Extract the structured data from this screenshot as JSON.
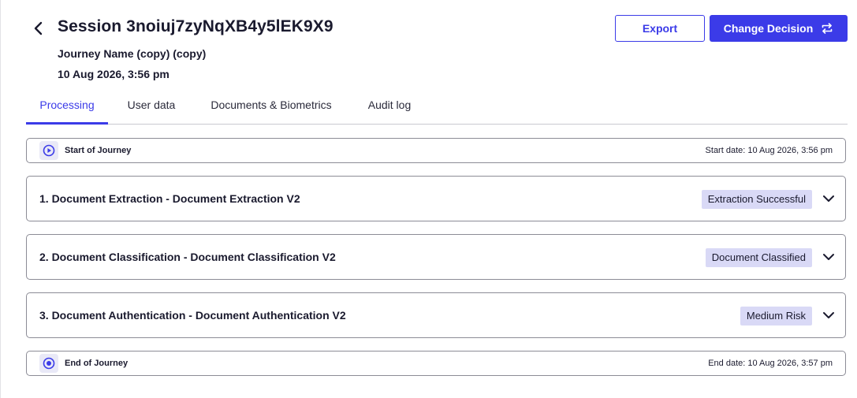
{
  "header": {
    "title": "Session 3noiuj7zyNqXB4y5lEK9X9",
    "journey_name": "Journey Name (copy) (copy)",
    "date": "10 Aug 2026, 3:56 pm",
    "back_icon": "chevron-left-icon"
  },
  "actions": {
    "export_label": "Export",
    "change_decision_label": "Change Decision",
    "change_decision_icon": "swap-arrows-icon"
  },
  "tabs": [
    {
      "label": "Processing",
      "active": true
    },
    {
      "label": "User data",
      "active": false
    },
    {
      "label": "Documents & Biometrics",
      "active": false
    },
    {
      "label": "Audit log",
      "active": false
    }
  ],
  "timeline": {
    "start": {
      "label": "Start of Journey",
      "date_text": "Start date: 10 Aug 2026, 3:56 pm",
      "icon": "play-circle-icon"
    },
    "steps": [
      {
        "title": "1. Document Extraction - Document Extraction V2",
        "status": "Extraction Successful"
      },
      {
        "title": "2. Document Classification - Document Classification V2",
        "status": "Document Classified"
      },
      {
        "title": "3. Document Authentication - Document Authentication V2",
        "status": "Medium Risk"
      }
    ],
    "end": {
      "label": "End of Journey",
      "date_text": "End date: 10 Aug 2026, 3:57 pm",
      "icon": "stop-circle-icon"
    }
  },
  "colors": {
    "accent": "#3b3be8",
    "badge_bg": "#d9d9f6",
    "text": "#1a1a2e",
    "border": "#8c8c96"
  }
}
